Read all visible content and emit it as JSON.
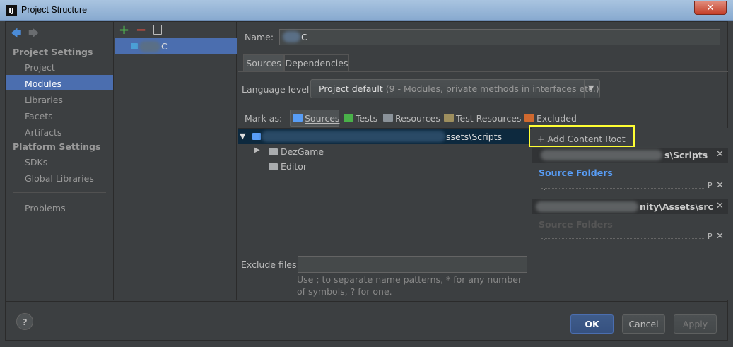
{
  "window": {
    "title": "Project Structure",
    "app_icon": "IJ",
    "close": "✕"
  },
  "nav": {
    "project_settings_header": "Project Settings",
    "project_settings": [
      "Project",
      "Modules",
      "Libraries",
      "Facets",
      "Artifacts"
    ],
    "platform_settings_header": "Platform Settings",
    "platform_settings": [
      "SDKs",
      "Global Libraries"
    ],
    "problems": "Problems",
    "selected": "Modules"
  },
  "module_list": {
    "selected_suffix": "C"
  },
  "name_field": {
    "label": "Name:",
    "value": "C"
  },
  "tabs": [
    "Sources",
    "Dependencies"
  ],
  "language_level": {
    "label": "Language level:",
    "value": "Project default",
    "detail": "(9 - Modules, private methods in interfaces etc.)"
  },
  "mark_as": {
    "label": "Mark as:",
    "items": [
      "Sources",
      "Tests",
      "Resources",
      "Test Resources",
      "Excluded"
    ]
  },
  "tree": {
    "root_suffix": "ssets\\Scripts",
    "children": [
      "DezGame",
      "Editor"
    ]
  },
  "exclude": {
    "label": "Exclude files:",
    "hint": "Use ; to separate name patterns, * for any number of symbols, ? for one."
  },
  "content_roots": {
    "add_label": "+ Add Content Root",
    "roots": [
      {
        "path_suffix": "s\\Scripts",
        "folders_label": "Source Folders",
        "folder_value": "."
      },
      {
        "path_suffix": "nity\\Assets\\src",
        "folders_label": "Source Folders",
        "folder_value": "."
      }
    ]
  },
  "buttons": {
    "ok": "OK",
    "cancel": "Cancel",
    "apply": "Apply",
    "help": "?"
  },
  "colors": {
    "selection": "#4b6eaf",
    "highlight_box": "#ffff33",
    "source_folder": "#589df6"
  }
}
